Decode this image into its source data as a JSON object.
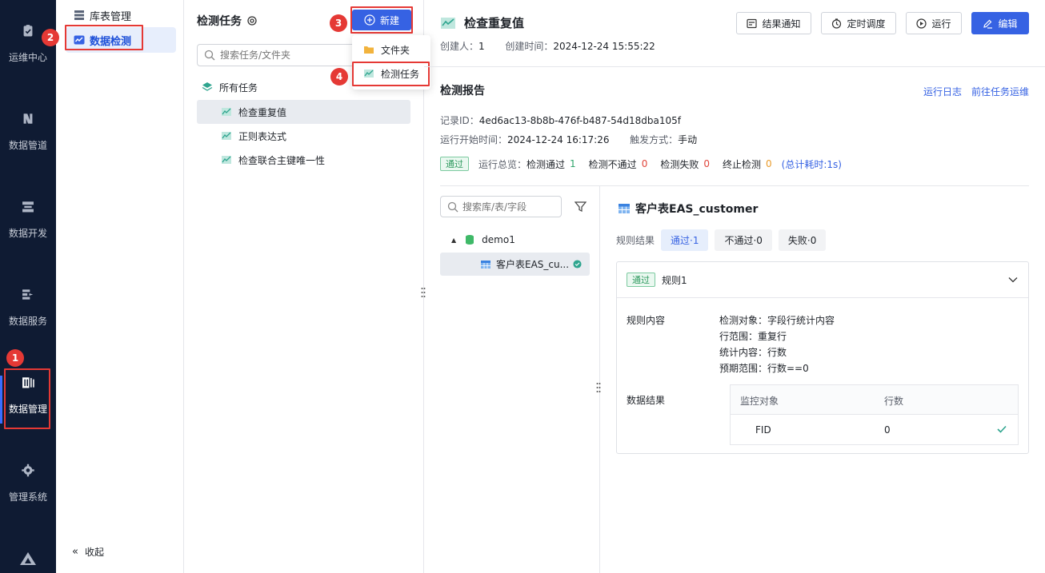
{
  "leftnav": {
    "items": [
      {
        "label": "运维中心",
        "icon": "clipboard-check-icon"
      },
      {
        "label": "数据管道",
        "icon": "pipeline-icon"
      },
      {
        "label": "数据开发",
        "icon": "server-stack-icon"
      },
      {
        "label": "数据服务",
        "icon": "service-icon"
      },
      {
        "label": "数据管理",
        "icon": "data-management-icon"
      },
      {
        "label": "管理系统",
        "icon": "gear-icon"
      }
    ],
    "active": "数据管理"
  },
  "subnav": {
    "items": [
      {
        "label": "库表管理",
        "icon": "database-table-icon"
      },
      {
        "label": "数据检测",
        "icon": "data-check-icon"
      }
    ],
    "collapse_label": "收起"
  },
  "taskpanel": {
    "title": "检测任务",
    "new_button": "新建",
    "search_placeholder": "搜索任务/文件夹",
    "root": "所有任务",
    "tasks": [
      "检查重复值",
      "正则表达式",
      "检查联合主键唯一性"
    ]
  },
  "dropdown": {
    "items": [
      {
        "label": "文件夹",
        "icon": "folder-icon"
      },
      {
        "label": "检测任务",
        "icon": "task-chart-icon"
      }
    ]
  },
  "badges": [
    "1",
    "2",
    "3",
    "4"
  ],
  "main": {
    "title": "检查重复值",
    "creator_label": "创建人：",
    "creator": "1",
    "created_label": "创建时间：",
    "created": "2024-12-24 15:55:22",
    "buttons": {
      "notify": "结果通知",
      "schedule": "定时调度",
      "run": "运行",
      "edit": "编辑"
    },
    "report": {
      "title": "检测报告",
      "run_log": "运行日志",
      "go_ops": "前往任务运维",
      "record_id_label": "记录ID：",
      "record_id": "4ed6ac13-8b8b-476f-b487-54d18dba105f",
      "start_label": "运行开始时间：",
      "start": "2024-12-24 16:17:26",
      "trigger_label": "触发方式：",
      "trigger": "手动",
      "status_tag": "通过",
      "overview_label": "运行总览：",
      "pass_label": "检测通过",
      "pass_count": "1",
      "fail_label": "检测不通过",
      "fail_count": "0",
      "error_label": "检测失败",
      "error_count": "0",
      "stop_label": "终止检测",
      "stop_count": "0",
      "total_time": "(总计耗时:1s)"
    },
    "tree": {
      "search_placeholder": "搜索库/表/字段",
      "db": "demo1",
      "table": "客户表EAS_cu..."
    },
    "detail": {
      "table_name": "客户表EAS_customer",
      "rule_result_label": "规则结果",
      "chips": [
        "通过·1",
        "不通过·0",
        "失败·0"
      ],
      "rule": {
        "status": "通过",
        "name": "规则1",
        "content_label": "规则内容",
        "content_lines": [
          "检测对象：字段行统计内容",
          "行范围：重复行",
          "统计内容：行数",
          "预期范围：行数==0"
        ],
        "result_label": "数据结果",
        "table_headers": [
          "监控对象",
          "行数"
        ],
        "rows": [
          {
            "object": "FID",
            "count": "0"
          }
        ]
      }
    }
  },
  "colors": {
    "nav_bg": "#0f1b33",
    "primary": "#3662e3",
    "highlight_red": "#e53935",
    "pass_green": "#2fa56b"
  }
}
